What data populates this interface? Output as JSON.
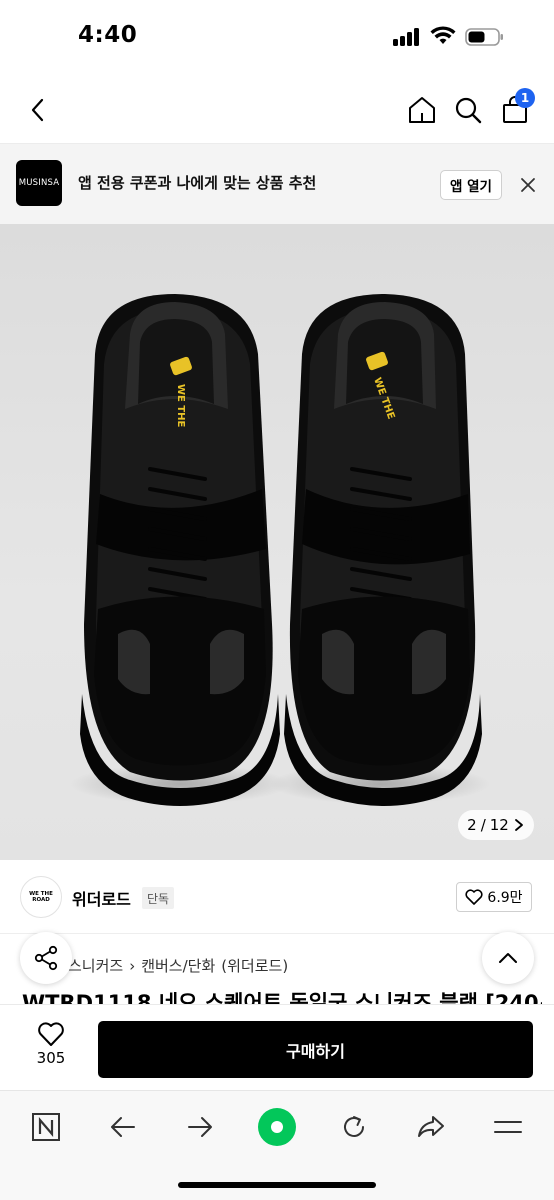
{
  "status_bar": {
    "time": "4:40"
  },
  "nav": {
    "cart_count": "1"
  },
  "app_banner": {
    "logo_text": "MUSINSA",
    "message": "앱 전용 쿠폰과 나에게 맞는 상품 추천",
    "open_label": "앱 열기"
  },
  "gallery": {
    "current": "2",
    "separator": "/",
    "total": "12",
    "next_icon": "chevron-right-icon"
  },
  "brand": {
    "logo_text": "WE THE ROAD",
    "name": "위더로드",
    "badge": "단독",
    "likes": "6.9만"
  },
  "breadcrumb": [
    "스니커즈",
    "캔버스/단화",
    "(위더로드)"
  ],
  "product": {
    "title": "WTRD1118 네오 스퀘어토 독일군 스니커즈 블랙 [240~",
    "insole_text": "WE THE"
  },
  "buy_bar": {
    "wish_count": "305",
    "buy_label": "구매하기"
  },
  "browser_toolbar": {
    "icons": [
      "naver-n-icon",
      "back-arrow-icon",
      "forward-arrow-icon",
      "green-dot-icon",
      "refresh-icon",
      "share-arrow-icon",
      "menu-icon"
    ]
  },
  "colors": {
    "accent_blue": "#1e63f0",
    "naver_green": "#03c75a",
    "buy_button": "#000000"
  }
}
